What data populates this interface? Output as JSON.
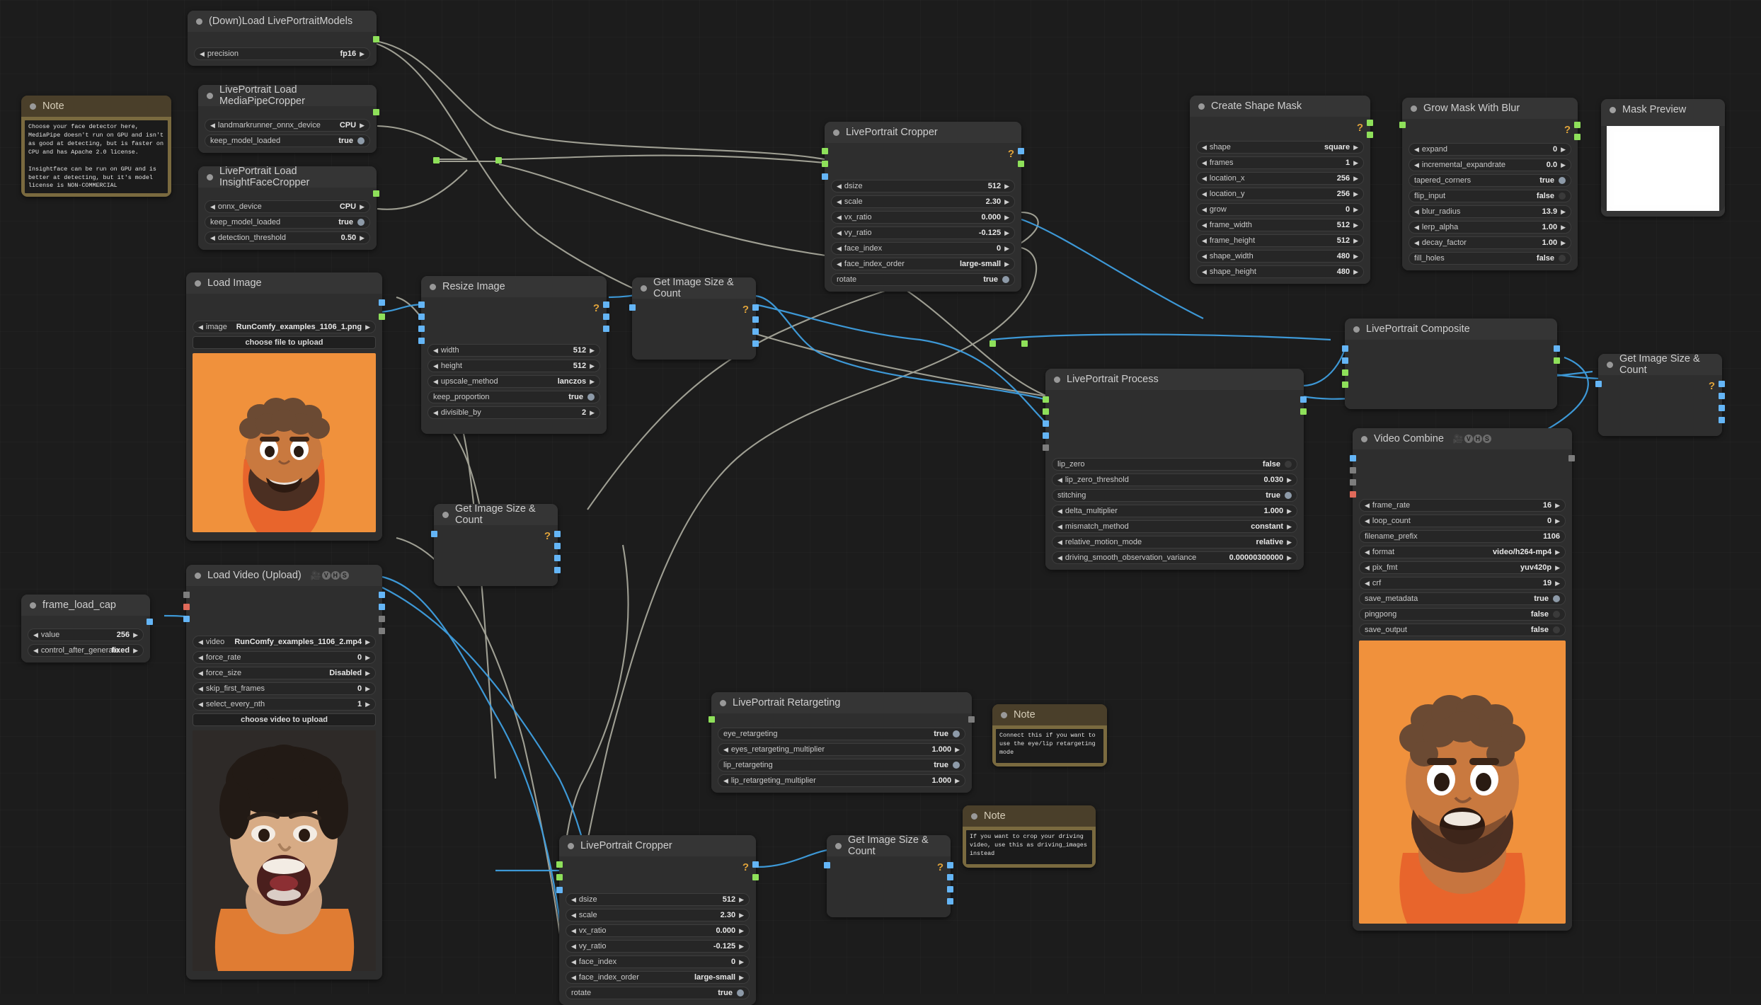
{
  "app": "ComfyUI LivePortrait workflow graph",
  "nodes": {
    "load_models": {
      "title": "(Down)Load LivePortraitModels",
      "widgets": [
        {
          "label": "precision",
          "value": "fp16",
          "type": "combo"
        }
      ]
    },
    "mediapipe": {
      "title": "LivePortrait Load MediaPipeCropper",
      "widgets": [
        {
          "label": "landmarkrunner_onnx_device",
          "value": "CPU",
          "type": "combo"
        },
        {
          "label": "keep_model_loaded",
          "value": "true",
          "type": "bool"
        }
      ]
    },
    "insightface": {
      "title": "LivePortrait Load InsightFaceCropper",
      "widgets": [
        {
          "label": "onnx_device",
          "value": "CPU",
          "type": "combo"
        },
        {
          "label": "keep_model_loaded",
          "value": "true",
          "type": "bool"
        },
        {
          "label": "detection_threshold",
          "value": "0.50",
          "type": "combo"
        }
      ]
    },
    "note_detector": {
      "title": "Note",
      "text": "Choose your face detector here,\nMediaPipe doesn't run on GPU and isn't\nas good at detecting, but is faster on\nCPU and has Apache 2.0 license.\n\nInsightface can be run on GPU and is\nbetter at detecting, but it's model\nlicense is NON-COMMERCIAL"
    },
    "load_image": {
      "title": "Load Image",
      "widgets": [
        {
          "label": "image",
          "value": "RunComfy_examples_1106_1.png",
          "type": "combo"
        },
        {
          "label": "choose file to upload",
          "value": "",
          "type": "button"
        }
      ]
    },
    "resize_image": {
      "title": "Resize Image",
      "widgets": [
        {
          "label": "width",
          "value": "512",
          "type": "combo"
        },
        {
          "label": "height",
          "value": "512",
          "type": "combo"
        },
        {
          "label": "upscale_method",
          "value": "lanczos",
          "type": "combo"
        },
        {
          "label": "keep_proportion",
          "value": "true",
          "type": "bool"
        },
        {
          "label": "divisible_by",
          "value": "2",
          "type": "combo"
        }
      ]
    },
    "gisc_top": {
      "title": "Get Image Size & Count"
    },
    "gisc_mid": {
      "title": "Get Image Size & Count"
    },
    "gisc_right": {
      "title": "Get Image Size & Count"
    },
    "gisc_bottom": {
      "title": "Get Image Size & Count"
    },
    "cropper_top": {
      "title": "LivePortrait Cropper",
      "widgets": [
        {
          "label": "dsize",
          "value": "512",
          "type": "combo"
        },
        {
          "label": "scale",
          "value": "2.30",
          "type": "combo"
        },
        {
          "label": "vx_ratio",
          "value": "0.000",
          "type": "combo"
        },
        {
          "label": "vy_ratio",
          "value": "-0.125",
          "type": "combo"
        },
        {
          "label": "face_index",
          "value": "0",
          "type": "combo"
        },
        {
          "label": "face_index_order",
          "value": "large-small",
          "type": "combo"
        },
        {
          "label": "rotate",
          "value": "true",
          "type": "bool"
        }
      ]
    },
    "cropper_bottom": {
      "title": "LivePortrait Cropper",
      "widgets": [
        {
          "label": "dsize",
          "value": "512",
          "type": "combo"
        },
        {
          "label": "scale",
          "value": "2.30",
          "type": "combo"
        },
        {
          "label": "vx_ratio",
          "value": "0.000",
          "type": "combo"
        },
        {
          "label": "vy_ratio",
          "value": "-0.125",
          "type": "combo"
        },
        {
          "label": "face_index",
          "value": "0",
          "type": "combo"
        },
        {
          "label": "face_index_order",
          "value": "large-small",
          "type": "combo"
        },
        {
          "label": "rotate",
          "value": "true",
          "type": "bool"
        }
      ]
    },
    "create_shape_mask": {
      "title": "Create Shape Mask",
      "widgets": [
        {
          "label": "shape",
          "value": "square",
          "type": "combo"
        },
        {
          "label": "frames",
          "value": "1",
          "type": "combo"
        },
        {
          "label": "location_x",
          "value": "256",
          "type": "combo"
        },
        {
          "label": "location_y",
          "value": "256",
          "type": "combo"
        },
        {
          "label": "grow",
          "value": "0",
          "type": "combo"
        },
        {
          "label": "frame_width",
          "value": "512",
          "type": "combo"
        },
        {
          "label": "frame_height",
          "value": "512",
          "type": "combo"
        },
        {
          "label": "shape_width",
          "value": "480",
          "type": "combo"
        },
        {
          "label": "shape_height",
          "value": "480",
          "type": "combo"
        }
      ]
    },
    "grow_mask": {
      "title": "Grow Mask With Blur",
      "widgets": [
        {
          "label": "expand",
          "value": "0",
          "type": "combo"
        },
        {
          "label": "incremental_expandrate",
          "value": "0.0",
          "type": "combo"
        },
        {
          "label": "tapered_corners",
          "value": "true",
          "type": "bool"
        },
        {
          "label": "flip_input",
          "value": "false",
          "type": "bool"
        },
        {
          "label": "blur_radius",
          "value": "13.9",
          "type": "combo"
        },
        {
          "label": "lerp_alpha",
          "value": "1.00",
          "type": "combo"
        },
        {
          "label": "decay_factor",
          "value": "1.00",
          "type": "combo"
        },
        {
          "label": "fill_holes",
          "value": "false",
          "type": "bool"
        }
      ]
    },
    "mask_preview": {
      "title": "Mask Preview"
    },
    "lp_composite": {
      "title": "LivePortrait Composite"
    },
    "lp_process": {
      "title": "LivePortrait Process",
      "widgets": [
        {
          "label": "lip_zero",
          "value": "false",
          "type": "bool"
        },
        {
          "label": "lip_zero_threshold",
          "value": "0.030",
          "type": "combo"
        },
        {
          "label": "stitching",
          "value": "true",
          "type": "bool"
        },
        {
          "label": "delta_multiplier",
          "value": "1.000",
          "type": "combo"
        },
        {
          "label": "mismatch_method",
          "value": "constant",
          "type": "combo"
        },
        {
          "label": "relative_motion_mode",
          "value": "relative",
          "type": "combo"
        },
        {
          "label": "driving_smooth_observation_variance",
          "value": "0.00000300000",
          "type": "combo"
        }
      ]
    },
    "video_combine": {
      "title": "Video Combine",
      "badge": "VHS",
      "widgets": [
        {
          "label": "frame_rate",
          "value": "16",
          "type": "combo"
        },
        {
          "label": "loop_count",
          "value": "0",
          "type": "combo"
        },
        {
          "label": "filename_prefix",
          "value": "1106",
          "type": "plain"
        },
        {
          "label": "format",
          "value": "video/h264-mp4",
          "type": "combo"
        },
        {
          "label": "pix_fmt",
          "value": "yuv420p",
          "type": "combo"
        },
        {
          "label": "crf",
          "value": "19",
          "type": "combo"
        },
        {
          "label": "save_metadata",
          "value": "true",
          "type": "bool"
        },
        {
          "label": "pingpong",
          "value": "false",
          "type": "bool"
        },
        {
          "label": "save_output",
          "value": "false",
          "type": "bool"
        }
      ]
    },
    "frame_load_cap": {
      "title": "frame_load_cap",
      "widgets": [
        {
          "label": "value",
          "value": "256",
          "type": "combo"
        },
        {
          "label": "control_after_generate",
          "value": "fixed",
          "type": "combo"
        }
      ]
    },
    "load_video": {
      "title": "Load Video (Upload)",
      "badge": "VHS",
      "widgets": [
        {
          "label": "video",
          "value": "RunComfy_examples_1106_2.mp4",
          "type": "combo"
        },
        {
          "label": "force_rate",
          "value": "0",
          "type": "combo"
        },
        {
          "label": "force_size",
          "value": "Disabled",
          "type": "combo"
        },
        {
          "label": "skip_first_frames",
          "value": "0",
          "type": "combo"
        },
        {
          "label": "select_every_nth",
          "value": "1",
          "type": "combo"
        },
        {
          "label": "choose video to upload",
          "value": "",
          "type": "button"
        }
      ]
    },
    "retargeting": {
      "title": "LivePortrait Retargeting",
      "widgets": [
        {
          "label": "eye_retargeting",
          "value": "true",
          "type": "bool"
        },
        {
          "label": "eyes_retargeting_multiplier",
          "value": "1.000",
          "type": "combo"
        },
        {
          "label": "lip_retargeting",
          "value": "true",
          "type": "bool"
        },
        {
          "label": "lip_retargeting_multiplier",
          "value": "1.000",
          "type": "combo"
        }
      ]
    },
    "note_retarget": {
      "title": "Note",
      "text": "Connect this if you want to\nuse the eye/lip retargeting\nmode"
    },
    "note_driving": {
      "title": "Note",
      "text": "If you want to crop your driving\nvideo, use this as driving_images\ninstead"
    }
  },
  "colors": {
    "canvas": "#1c1c1c",
    "node_title": "#353535",
    "node_body": "#2e2e2e",
    "note_title": "#4a3f2a",
    "note_body": "#7a6a3f",
    "link_grey": "#b6b6a8",
    "link_blue": "#3f9fe0",
    "slot_image": "#64b5f6",
    "slot_pipe": "#8ee05a",
    "help": "#e0a33a"
  }
}
